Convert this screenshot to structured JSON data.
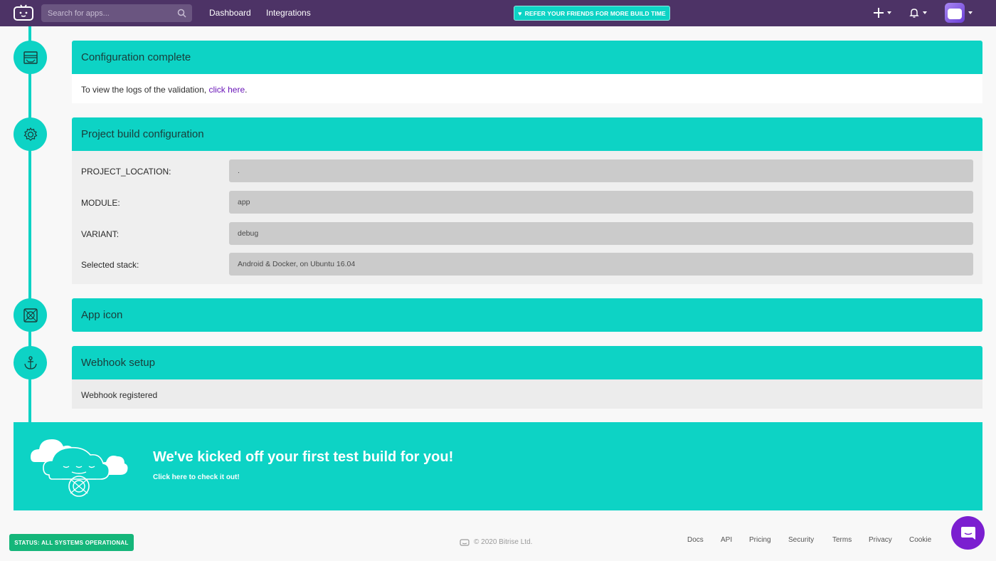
{
  "nav": {
    "search_placeholder": "Search for apps...",
    "links": [
      "Dashboard",
      "Integrations"
    ],
    "refer_label": "REFER YOUR FRIENDS FOR MORE BUILD TIME"
  },
  "sections": {
    "config_complete": {
      "title": "Configuration complete",
      "text": "To view the logs of the validation, ",
      "link": "click here",
      "suffix": "."
    },
    "project_build": {
      "title": "Project build configuration",
      "rows": [
        {
          "label": "PROJECT_LOCATION:",
          "value": "."
        },
        {
          "label": "MODULE:",
          "value": "app"
        },
        {
          "label": "VARIANT:",
          "value": "debug"
        },
        {
          "label": "Selected stack:",
          "value": "Android & Docker, on Ubuntu 16.04"
        }
      ]
    },
    "app_icon": {
      "title": "App icon"
    },
    "webhook": {
      "title": "Webhook setup",
      "text": "Webhook registered"
    }
  },
  "banner": {
    "title": "We've kicked off your first test build for you!",
    "link": "Click here to check it out!"
  },
  "footer": {
    "status": "STATUS: ALL SYSTEMS OPERATIONAL",
    "copyright": "© 2020 Bitrise Ltd.",
    "links": [
      "Docs",
      "API",
      "Pricing",
      "Security",
      "Terms",
      "Privacy",
      "Cookie"
    ]
  },
  "colors": {
    "nav_bg": "#4d3366",
    "accent": "#0dd3c5",
    "status_green": "#15b67a",
    "chat_purple": "#7b1fd0",
    "link_purple": "#6a16b8"
  }
}
